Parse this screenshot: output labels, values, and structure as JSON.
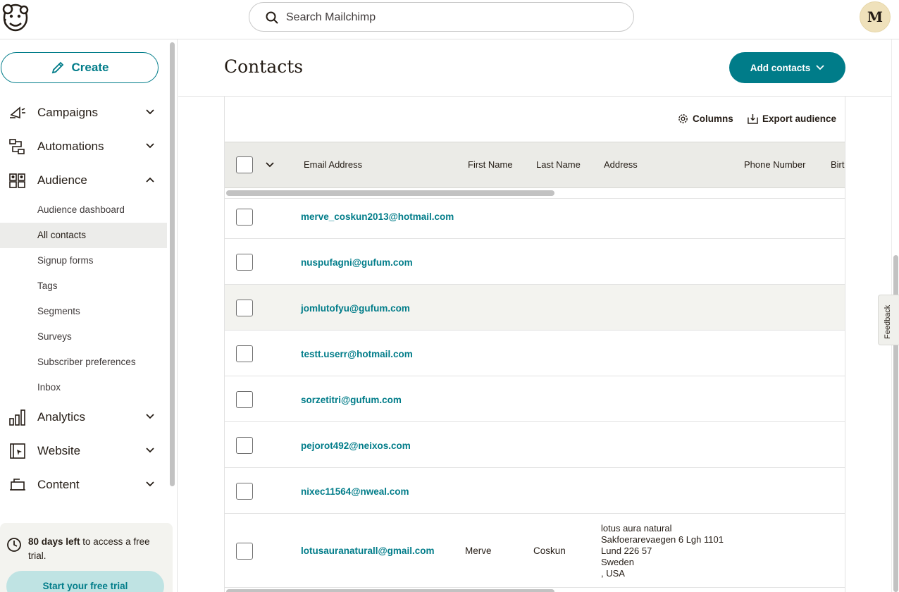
{
  "topbar": {
    "search_placeholder": "Search Mailchimp",
    "avatar_initial": "M"
  },
  "sidebar": {
    "create_label": "Create",
    "nav": [
      {
        "label": "Campaigns",
        "icon": "megaphone-icon",
        "expanded": false
      },
      {
        "label": "Automations",
        "icon": "automation-flow-icon",
        "expanded": false
      },
      {
        "label": "Audience",
        "icon": "audience-icon",
        "expanded": true
      },
      {
        "label": "Analytics",
        "icon": "bar-chart-icon",
        "expanded": false
      },
      {
        "label": "Website",
        "icon": "website-icon",
        "expanded": false
      },
      {
        "label": "Content",
        "icon": "content-icon",
        "expanded": false
      }
    ],
    "audience_sub": [
      {
        "label": "Audience dashboard",
        "active": false
      },
      {
        "label": "All contacts",
        "active": true
      },
      {
        "label": "Signup forms",
        "active": false
      },
      {
        "label": "Tags",
        "active": false
      },
      {
        "label": "Segments",
        "active": false
      },
      {
        "label": "Surveys",
        "active": false
      },
      {
        "label": "Subscriber preferences",
        "active": false
      },
      {
        "label": "Inbox",
        "active": false
      }
    ],
    "trial": {
      "days_bold": "80 days left",
      "rest": " to access a free trial.",
      "button": "Start your free trial"
    }
  },
  "main": {
    "title": "Contacts",
    "add_contacts_label": "Add contacts",
    "tools": {
      "columns_label": "Columns",
      "export_label": "Export audience"
    },
    "columns": [
      "Email Address",
      "First Name",
      "Last Name",
      "Address",
      "Phone Number",
      "Birt"
    ],
    "rows": [
      {
        "email": "merve_coskun2013@hotmail.com",
        "first": "",
        "last": "",
        "address": []
      },
      {
        "email": "nuspufagni@gufum.com",
        "first": "",
        "last": "",
        "address": []
      },
      {
        "email": "jomlutofyu@gufum.com",
        "first": "",
        "last": "",
        "address": []
      },
      {
        "email": "testt.userr@hotmail.com",
        "first": "",
        "last": "",
        "address": []
      },
      {
        "email": "sorzetitri@gufum.com",
        "first": "",
        "last": "",
        "address": []
      },
      {
        "email": "pejorot492@neixos.com",
        "first": "",
        "last": "",
        "address": []
      },
      {
        "email": "nixec11564@nweal.com",
        "first": "",
        "last": "",
        "address": []
      },
      {
        "email": "lotusauranaturall@gmail.com",
        "first": "Merve",
        "last": "Coskun",
        "address": [
          "lotus aura natural",
          "Sakfoerarevaegen 6 Lgh 1101",
          "Lund 226 57",
          "Sweden",
          ", USA"
        ]
      }
    ]
  },
  "feedback_label": "Feedback",
  "colors": {
    "accent": "#007c89",
    "trial_button": "#bfe3e3",
    "header_row": "#ebebe7"
  }
}
